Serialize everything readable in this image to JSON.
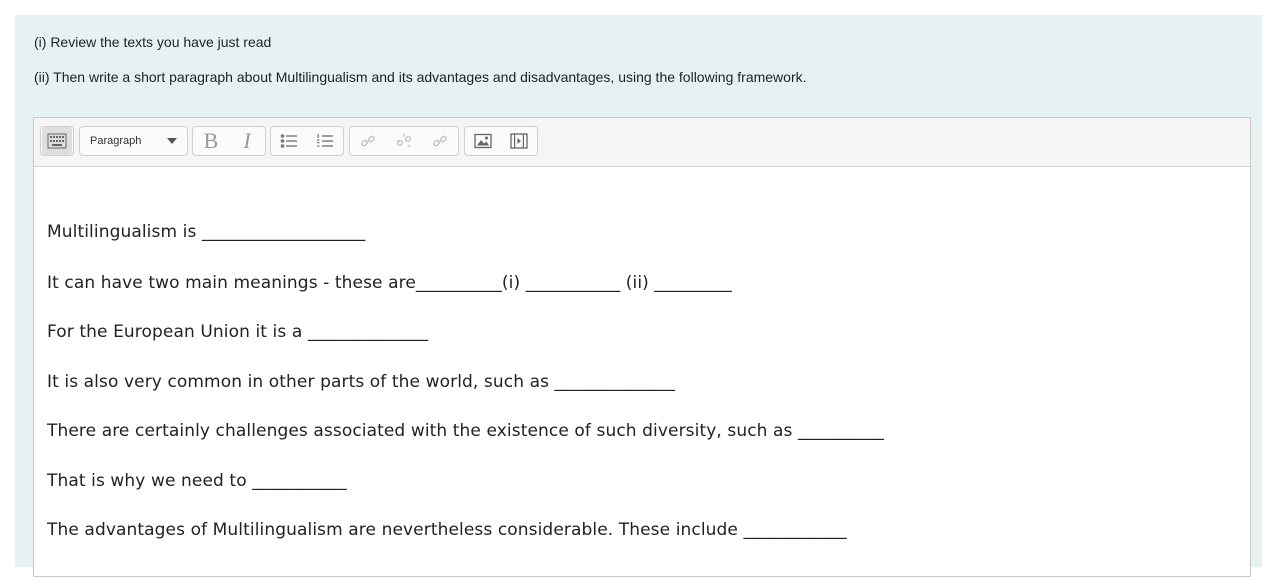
{
  "instructions": {
    "line1": "(i) Review the texts you have just read",
    "line2": "(ii) Then write a short paragraph about Multilingualism and its advantages and disadvantages, using the following framework."
  },
  "toolbar": {
    "toggle_icon": "keyboard-toggle-icon",
    "format_select": "Paragraph",
    "bold_label": "B",
    "italic_label": "I",
    "icons": [
      "unordered-list-icon",
      "ordered-list-icon",
      "link-icon",
      "unlink-icon",
      "anchor-icon",
      "image-icon",
      "media-icon"
    ]
  },
  "content": {
    "lines": [
      "Multilingualism is ___________________",
      "It can have two main meanings - these are__________(i) ___________ (ii) _________",
      "For the European Union it is a ______________",
      "It is also very common in other parts of the world, such as ______________",
      "There are certainly challenges associated with the existence of such diversity, such as __________",
      "That is why we need to ___________",
      "The advantages of Multilingualism are nevertheless considerable. These include ____________"
    ]
  }
}
